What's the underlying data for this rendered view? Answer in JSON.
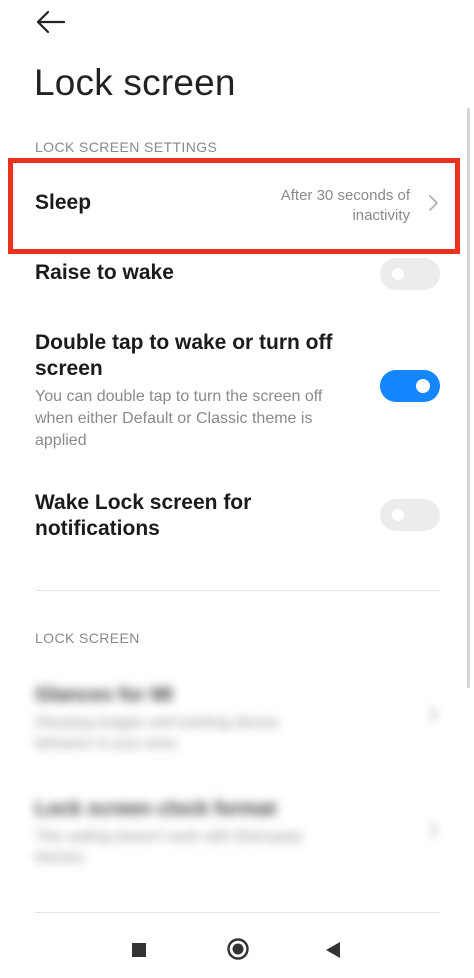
{
  "header": {
    "back_icon": "arrow-left-icon",
    "title": "Lock screen"
  },
  "sections": {
    "settings_header": "LOCK SCREEN SETTINGS",
    "lock_header": "LOCK SCREEN"
  },
  "settings": {
    "sleep": {
      "title": "Sleep",
      "value_line1": "After 30 seconds of",
      "value_line2": "inactivity"
    },
    "raise_to_wake": {
      "title": "Raise to wake",
      "enabled": false
    },
    "double_tap": {
      "title_line1": "Double tap to wake or turn off",
      "title_line2": "screen",
      "desc_line1": "You can double tap to turn the screen off",
      "desc_line2": "when either Default or Classic theme is",
      "desc_line3": "applied",
      "enabled": true
    },
    "wake_notifications": {
      "title_line1": "Wake Lock screen for",
      "title_line2": "notifications",
      "enabled": false
    }
  },
  "blurred": {
    "item1": {
      "title": "Glances for MI",
      "desc_line1": "Showing images and tracking device",
      "desc_line2": "behavior in your area"
    },
    "item2": {
      "title": "Lock screen clock format",
      "desc_line1": "This setting doesn't work with third-party",
      "desc_line2": "themes"
    }
  },
  "colors": {
    "accent": "#1486ff",
    "highlight": "#e8321e"
  },
  "nav": {
    "recents_icon": "square-icon",
    "home_icon": "circle-icon",
    "back_icon": "triangle-left-icon"
  }
}
